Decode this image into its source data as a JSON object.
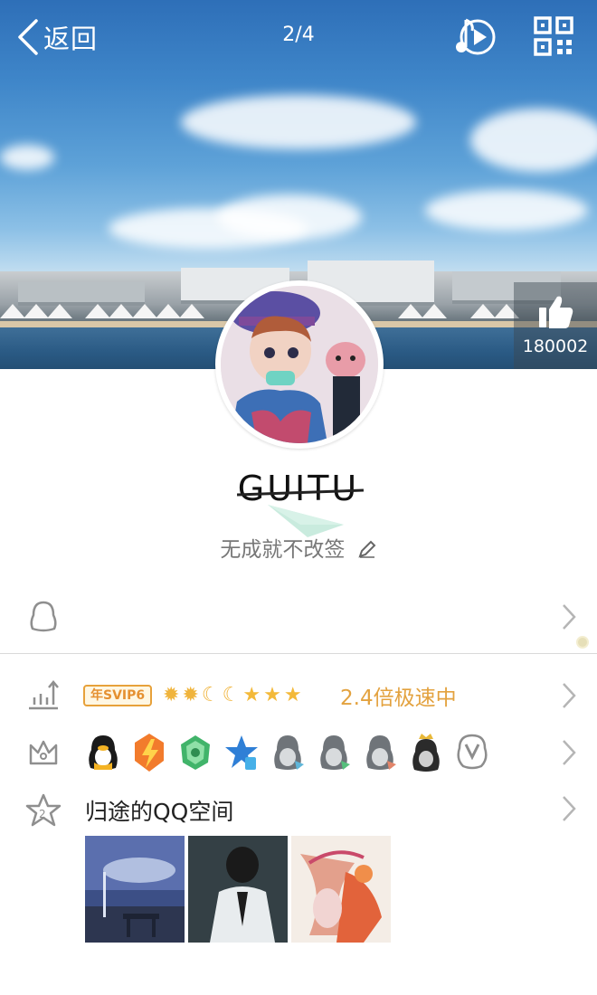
{
  "header": {
    "back_label": "返回",
    "page_indicator": "2/4",
    "like_count": "180002"
  },
  "profile": {
    "nickname": "GUITU",
    "signature": "无成就不改签"
  },
  "rows": {
    "vip_tag": "年SVIP6",
    "level_icons": [
      "sun",
      "sun",
      "moon",
      "moon",
      "star",
      "star",
      "star"
    ],
    "speed_text": "2.4倍极速中",
    "badges": [
      "qq-penguin-icon",
      "lightning-badge-icon",
      "game-badge-icon",
      "star-badge-icon",
      "penguin-gray-icon",
      "penguin-gray-icon",
      "penguin-gray-icon",
      "penguin-crown-icon",
      "v-badge-icon"
    ],
    "qzone_label": "归途的QQ空间"
  },
  "colors": {
    "accent_orange": "#e3a23f",
    "vip_border": "#e7a13a",
    "divider": "#dadada",
    "text_gray": "#777777"
  }
}
